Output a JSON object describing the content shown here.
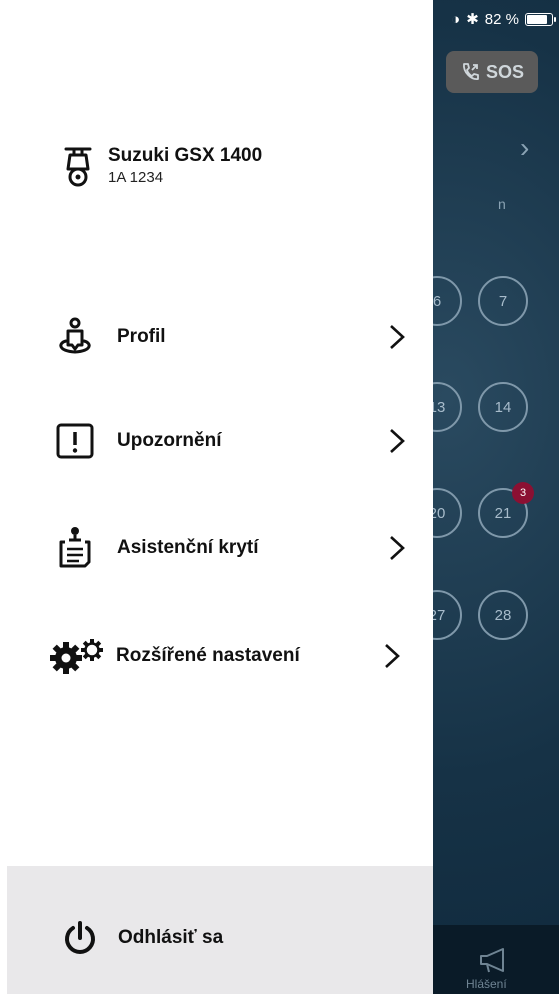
{
  "status_bar": {
    "battery_text": "82 %",
    "battery_level": 0.82
  },
  "background": {
    "sos_label": "SOS",
    "header_letter": "n",
    "days": [
      "6",
      "7",
      "13",
      "14",
      "20",
      "21",
      "27",
      "28"
    ],
    "badge_count": "3",
    "tab_label": "Hlášení"
  },
  "vehicle": {
    "name": "Suzuki GSX 1400",
    "plate": "1A 1234"
  },
  "menu": [
    {
      "label": "Profil",
      "icon": "profile-pin-icon"
    },
    {
      "label": "Upozornění",
      "icon": "alert-icon"
    },
    {
      "label": "Asistenční krytí",
      "icon": "clipboard-icon"
    },
    {
      "label": "Rozšířené nastavení",
      "icon": "gears-icon"
    }
  ],
  "logout": {
    "label": "Odhlásiť sa",
    "icon": "power-icon"
  }
}
